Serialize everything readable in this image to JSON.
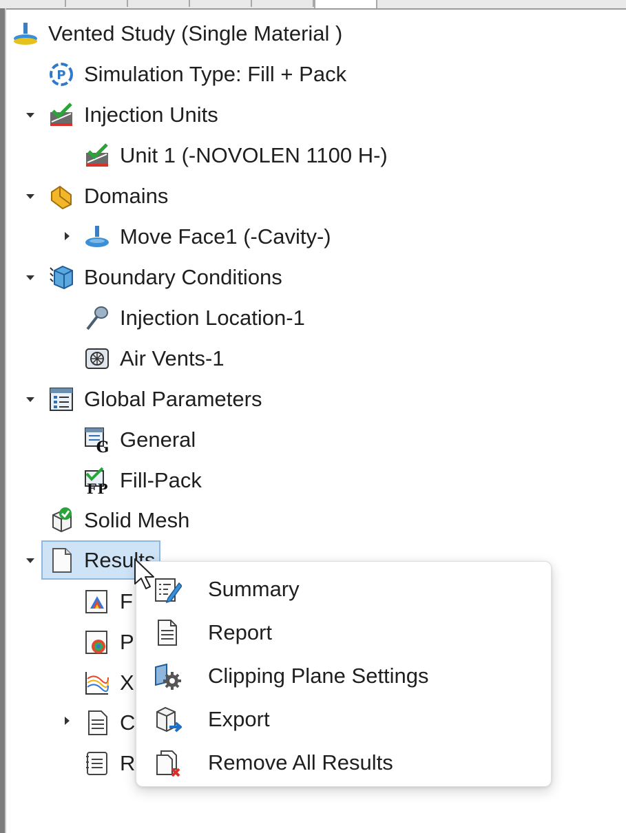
{
  "tree": {
    "root": "Vented Study (Single Material )",
    "simulation_type": "Simulation Type: Fill + Pack",
    "injection_units": "Injection Units",
    "unit1": "Unit 1 (-NOVOLEN 1100 H-)",
    "domains": "Domains",
    "move_face": "Move Face1 (-Cavity-)",
    "boundary_conditions": "Boundary Conditions",
    "injection_location": "Injection Location-1",
    "air_vents": "Air Vents-1",
    "global_parameters": "Global Parameters",
    "general": "General",
    "fill_pack": "Fill-Pack",
    "solid_mesh": "Solid Mesh",
    "results": "Results",
    "results_children_partial": [
      "F",
      "P",
      "X",
      "C",
      "R"
    ]
  },
  "context_menu": {
    "items": [
      {
        "label": "Summary",
        "icon": "summary-icon"
      },
      {
        "label": "Report",
        "icon": "report-icon"
      },
      {
        "label": "Clipping Plane Settings",
        "icon": "clipping-plane-gear-icon"
      },
      {
        "label": "Export",
        "icon": "export-icon"
      },
      {
        "label": "Remove All Results",
        "icon": "remove-results-icon"
      }
    ]
  },
  "colors": {
    "selection_fill": "#cfe3f7",
    "selection_border": "#8fb6dc",
    "text": "#1f1f1f"
  }
}
